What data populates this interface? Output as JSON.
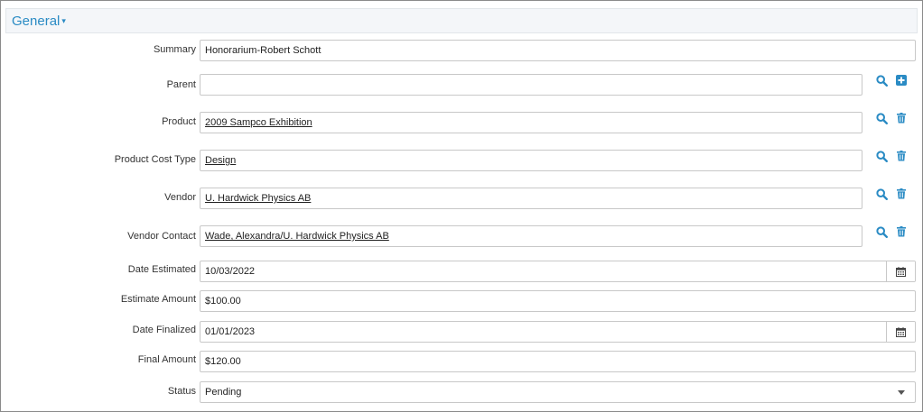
{
  "section": {
    "title": "General",
    "caret": "▾"
  },
  "colors": {
    "accent": "#2a8bc4",
    "border": "#c8c8c8",
    "header_bg": "#f4f6f9"
  },
  "fields": {
    "summary": {
      "label": "Summary",
      "value": "Honorarium-Robert Schott"
    },
    "parent": {
      "label": "Parent",
      "value": ""
    },
    "product": {
      "label": "Product",
      "value": "2009 Sampco Exhibition"
    },
    "product_cost_type": {
      "label": "Product Cost Type",
      "value": "Design"
    },
    "vendor": {
      "label": "Vendor",
      "value": "U. Hardwick Physics AB"
    },
    "vendor_contact": {
      "label": "Vendor Contact",
      "value": "Wade, Alexandra/U. Hardwick Physics AB"
    },
    "date_estimated": {
      "label": "Date Estimated",
      "value": "10/03/2022"
    },
    "estimate_amount": {
      "label": "Estimate Amount",
      "value": "$100.00"
    },
    "date_finalized": {
      "label": "Date Finalized",
      "value": "01/01/2023"
    },
    "final_amount": {
      "label": "Final Amount",
      "value": "$120.00"
    },
    "status": {
      "label": "Status",
      "value": "Pending"
    }
  },
  "icons": {
    "search": "search-icon",
    "add": "plus-square-icon",
    "delete": "trash-icon",
    "calendar": "calendar-icon",
    "dropdown": "chevron-down-icon"
  }
}
